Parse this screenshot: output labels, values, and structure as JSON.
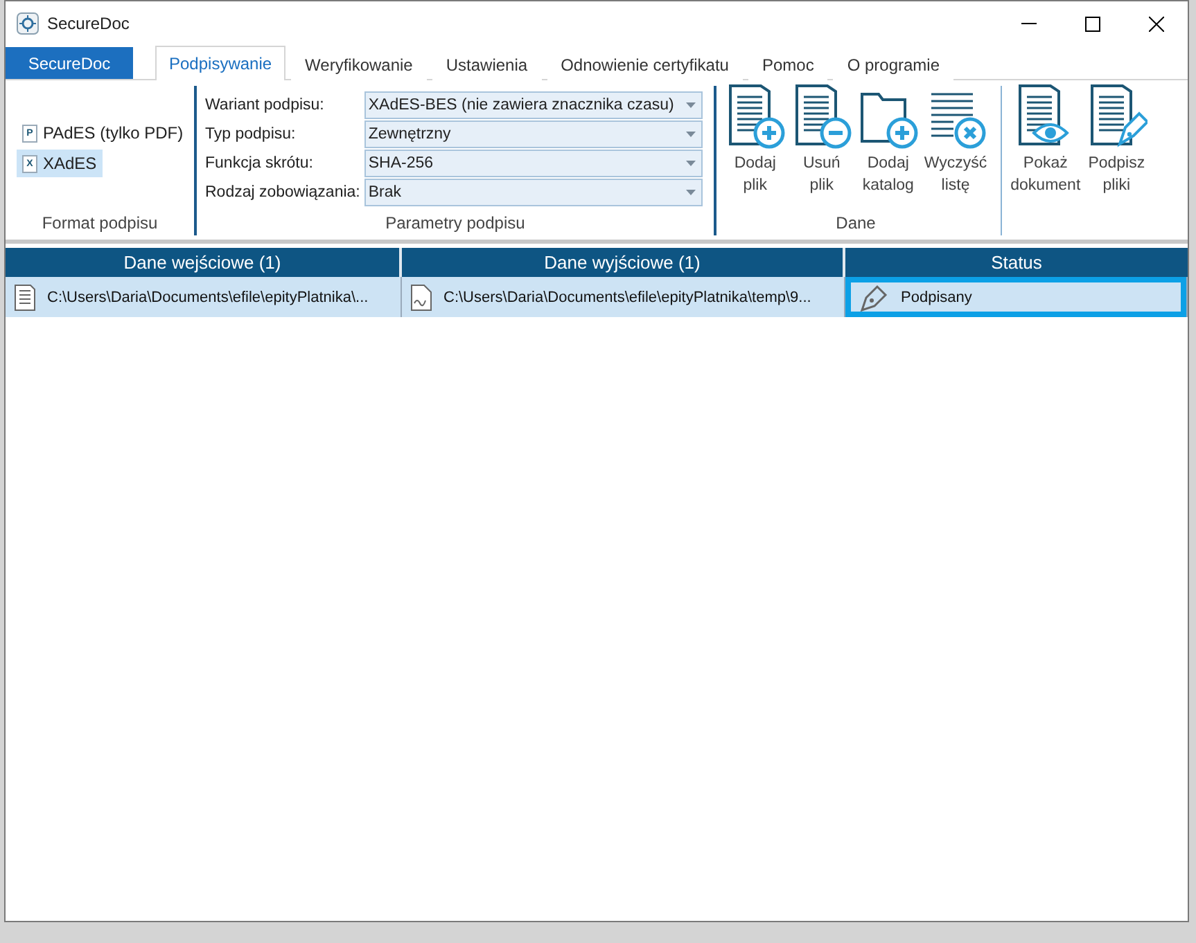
{
  "window": {
    "title": "SecureDoc"
  },
  "tabs": [
    {
      "label": "SecureDoc",
      "kind": "file",
      "selected": false
    },
    {
      "label": "Podpisywanie",
      "kind": "tab",
      "selected": true
    },
    {
      "label": "Weryfikowanie",
      "kind": "tab",
      "selected": false
    },
    {
      "label": "Ustawienia",
      "kind": "tab",
      "selected": false
    },
    {
      "label": "Odnowienie certyfikatu",
      "kind": "tab",
      "selected": false
    },
    {
      "label": "Pomoc",
      "kind": "tab",
      "selected": false
    },
    {
      "label": "O programie",
      "kind": "tab",
      "selected": false
    }
  ],
  "ribbon": {
    "groups": [
      {
        "kind": "formats",
        "label": "Format podpisu",
        "items": [
          {
            "label": "PAdES (tylko PDF)",
            "badge": "P",
            "selected": false
          },
          {
            "label": "XAdES",
            "badge": "X",
            "selected": true
          }
        ]
      },
      {
        "kind": "fields",
        "label": "Parametry podpisu",
        "fields": [
          {
            "label": "Wariant podpisu:",
            "value": "XAdES-BES (nie zawiera znacznika czasu)"
          },
          {
            "label": "Typ podpisu:",
            "value": "Zewnętrzny"
          },
          {
            "label": "Funkcja skrótu:",
            "value": "SHA-256"
          },
          {
            "label": "Rodzaj zobowiązania:",
            "value": "Brak"
          }
        ]
      },
      {
        "kind": "buttons",
        "label": "Dane",
        "buttons": [
          {
            "kind": "add-file",
            "lines": [
              "Dodaj",
              "plik"
            ]
          },
          {
            "kind": "remove-file",
            "lines": [
              "Usuń",
              "plik"
            ]
          },
          {
            "kind": "add-folder",
            "lines": [
              "Dodaj",
              "katalog"
            ]
          },
          {
            "kind": "clear-list",
            "lines": [
              "Wyczyść",
              "listę"
            ]
          }
        ]
      },
      {
        "kind": "buttons",
        "buttons": [
          {
            "kind": "view",
            "lines": [
              "Pokaż",
              "dokument"
            ]
          },
          {
            "kind": "sign",
            "lines": [
              "Podpisz",
              "pliki"
            ]
          }
        ]
      }
    ]
  },
  "table": {
    "columns": [
      "Dane wejściowe (1)",
      "Dane wyjściowe (1)",
      "Status"
    ],
    "rows": [
      {
        "selected": true,
        "cells": [
          {
            "kind": "text-doc",
            "text": "C:\\Users\\Daria\\Documents\\efile\\epityPlatnika\\..."
          },
          {
            "kind": "signed-doc",
            "text": "C:\\Users\\Daria\\Documents\\efile\\epityPlatnika\\temp\\9..."
          },
          {
            "kind": "pen",
            "text": "Podpisany",
            "highlighted": true
          }
        ]
      }
    ]
  }
}
